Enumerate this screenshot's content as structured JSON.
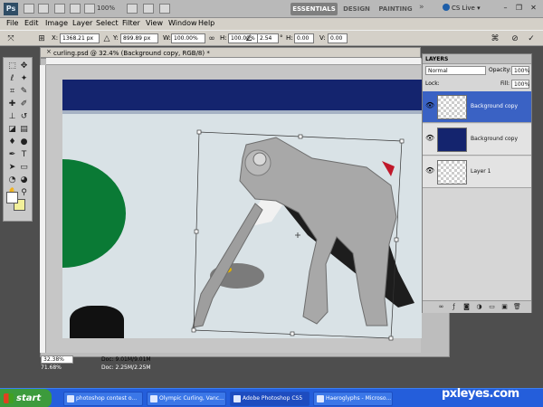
{
  "app": {
    "zoom": "100%",
    "workspace_tabs": [
      "ESSENTIALS",
      "DESIGN",
      "PAINTING"
    ],
    "more": "»",
    "cs_live": "CS Live ▾",
    "window_controls": [
      "–",
      "❐",
      "✕"
    ]
  },
  "menu": [
    "File",
    "Edit",
    "Image",
    "Layer",
    "Select",
    "Filter",
    "View",
    "Window",
    "Help"
  ],
  "options": {
    "x_label": "X:",
    "x_value": "1368.21 px",
    "y_label": "Y:",
    "y_value": "899.89 px",
    "w_label": "W:",
    "w_value": "100.00%",
    "h_label": "H:",
    "h_value": "100.00%",
    "angle_value": "2.54",
    "hskew_label": "H:",
    "hskew_value": "0.00",
    "vskew_label": "V:",
    "vskew_value": "0.00",
    "degree_symbol": "°"
  },
  "document": {
    "title": "curling.psd @ 32.4% (Background copy, RGB/8) *",
    "close": "×",
    "status_zoom": "32.38%",
    "status_doc": "Doc: 9.01M/9.01M",
    "status_zoom_2": "71.68%",
    "status_doc_2": "Doc: 2.25M/2.25M"
  },
  "layers_panel": {
    "title": "LAYERS",
    "blend_mode": "Normal",
    "opacity_label": "Opacity:",
    "opacity_value": "100%",
    "lock_label": "Lock:",
    "fill_label": "Fill:",
    "fill_value": "100%",
    "layers": [
      {
        "name": "Background copy",
        "selected": true
      },
      {
        "name": "Background copy",
        "selected": false
      },
      {
        "name": "Layer 1",
        "selected": false
      }
    ]
  },
  "taskbar": {
    "start": "start",
    "tasks": [
      "photoshop contest o...",
      "Olympic Curling, Vanc...",
      "Adobe Photoshop CS5",
      "Haeroglyphs - Microso..."
    ]
  },
  "watermark": "pxleyes.com",
  "colors": {
    "selected_layer": "#3a62c4",
    "taskbar": "#245edb",
    "start_button": "#3c9b3c",
    "foreground": "#ffffff",
    "background": "#f2f09a",
    "photo_wall": "#14246e",
    "photo_ice": "#d9e2e6",
    "photo_green": "#0a7a35"
  }
}
